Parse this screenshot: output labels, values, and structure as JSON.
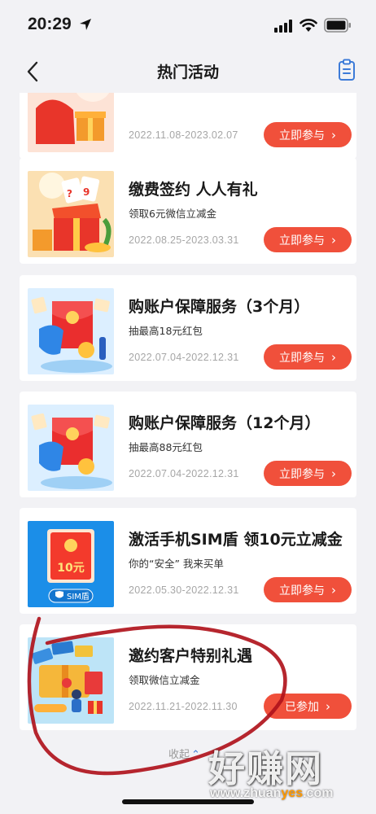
{
  "status_bar": {
    "time": "20:29"
  },
  "nav": {
    "title": "热门活动"
  },
  "colors": {
    "accent_red": "#f0503b",
    "nav_blue": "#3d7bd8",
    "date_gray": "#a6a6a6"
  },
  "activities": [
    {
      "title": "",
      "subtitle": "",
      "date": "2022.11.08-2023.02.07",
      "button": "立即参与",
      "state": "open"
    },
    {
      "title": "缴费签约 人人有礼",
      "subtitle": "领取6元微信立减金",
      "date": "2022.08.25-2023.03.31",
      "button": "立即参与",
      "state": "open"
    },
    {
      "title": "购账户保障服务（3个月）",
      "subtitle": "抽最高18元红包",
      "date": "2022.07.04-2022.12.31",
      "button": "立即参与",
      "state": "open"
    },
    {
      "title": "购账户保障服务（12个月）",
      "subtitle": "抽最高88元红包",
      "date": "2022.07.04-2022.12.31",
      "button": "立即参与",
      "state": "open"
    },
    {
      "title": "激活手机SIM盾 领10元立减金",
      "subtitle": "你的“安全” 我来买单",
      "date": "2022.05.30-2022.12.31",
      "button": "立即参与",
      "state": "open",
      "thumb_amount": "10元",
      "thumb_badge": "SIM盾"
    },
    {
      "title": "邀约客户特别礼遇",
      "subtitle": "领取微信立减金",
      "date": "2022.11.21-2022.11.30",
      "button": "已参加",
      "state": "joined"
    }
  ],
  "footer": {
    "collapse_label": "收起"
  },
  "watermark": {
    "brand": "好赚网",
    "url_prefix": "www.zhuan",
    "url_highlight": "yes",
    "url_suffix": ".com"
  }
}
